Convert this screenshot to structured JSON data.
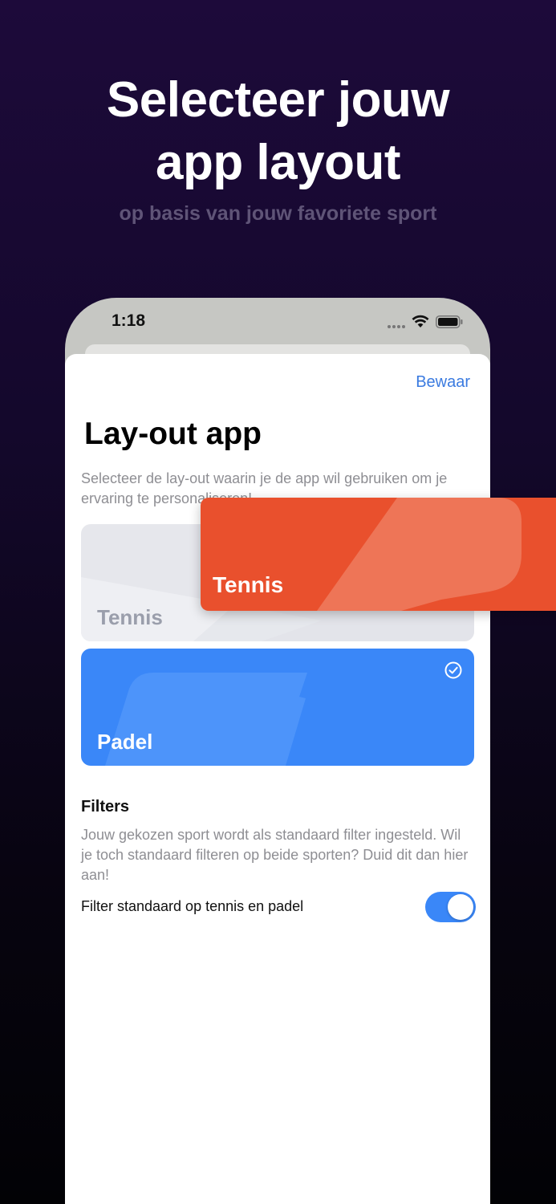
{
  "hero": {
    "title_line1": "Selecteer jouw",
    "title_line2": "app layout",
    "subtitle": "op basis van jouw favoriete sport"
  },
  "status_bar": {
    "time": "1:18"
  },
  "sheet": {
    "save_label": "Bewaar",
    "title": "Lay-out app",
    "description": "Selecteer de lay-out waarin je de app wil gebruiken om je ervaring te personaliseren!"
  },
  "layouts": [
    {
      "label": "Tennis",
      "selected": false
    },
    {
      "label": "Padel",
      "selected": true
    }
  ],
  "highlight_card": {
    "label": "Tennis"
  },
  "filters": {
    "title": "Filters",
    "description": "Jouw gekozen sport wordt als standaard filter ingesteld. Wil je toch standaard filteren op beide sporten? Duid dit dan hier aan!",
    "toggle_label": "Filter standaard op tennis en padel",
    "toggle_on": true
  },
  "colors": {
    "accent_blue": "#3a87f8",
    "link_blue": "#3b7be0",
    "tennis_orange": "#e9502d",
    "background_top": "#1d0a3a"
  }
}
